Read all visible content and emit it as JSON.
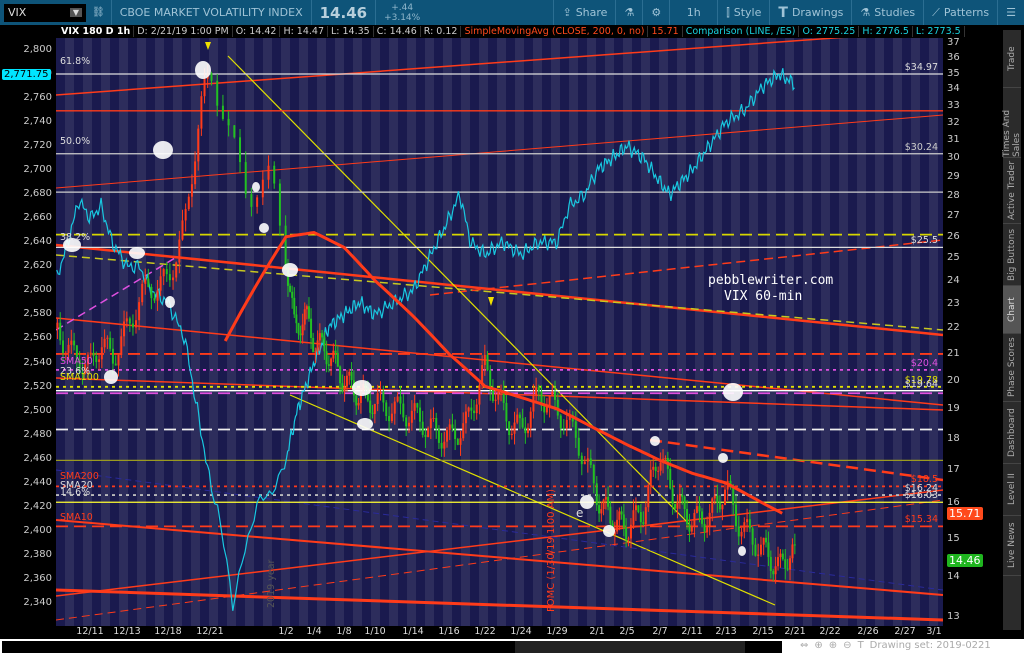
{
  "header": {
    "symbol": "VIX",
    "description": "CBOE MARKET VOLATILITY INDEX",
    "last": "14.46",
    "change": "+.44",
    "change_pct": "+3.14%",
    "buttons": [
      {
        "label": "Share",
        "icon": "share-icon"
      },
      {
        "label": "",
        "icon": "flask-icon"
      },
      {
        "label": "",
        "icon": "gear-icon"
      },
      {
        "label": "1h",
        "icon": ""
      },
      {
        "label": "Style",
        "icon": "candle-icon"
      },
      {
        "label": "Drawings",
        "icon": "text-t-icon"
      },
      {
        "label": "Studies",
        "icon": "flask-icon"
      },
      {
        "label": "Patterns",
        "icon": "pattern-icon"
      }
    ]
  },
  "infobar": {
    "title": "VIX 180 D 1h",
    "date": "D: 2/21/19 1:00 PM",
    "open": "O: 14.42",
    "high": "H: 14.47",
    "low": "L: 14.35",
    "close": "C: 14.46",
    "range": "R: 0.12",
    "study": "SimpleMovingAvg (CLOSE, 200, 0, no)",
    "study_value": "15.71",
    "comparison": "Comparison (LINE, /ES)",
    "cmp_open": "O: 2775.25",
    "cmp_high": "H: 2776.5",
    "cmp_low": "L: 2773.5"
  },
  "left_axis": {
    "ticks": [
      "2,800",
      "2,780",
      "2,760",
      "2,740",
      "2,720",
      "2,700",
      "2,680",
      "2,660",
      "2,640",
      "2,620",
      "2,600",
      "2,580",
      "2,560",
      "2,540",
      "2,520",
      "2,500",
      "2,480",
      "2,460",
      "2,440",
      "2,420",
      "2,400",
      "2,380",
      "2,360",
      "2,340"
    ],
    "tag": "2,771.75"
  },
  "right_axis": {
    "ticks": [
      "37",
      "36",
      "35",
      "34",
      "33",
      "32",
      "31",
      "30",
      "29",
      "28",
      "27",
      "26",
      "25",
      "24",
      "23",
      "22",
      "21",
      "20",
      "19",
      "18",
      "17",
      "16",
      "15",
      "14",
      "13"
    ],
    "tag_sma": "15.71",
    "tag_last": "14.46"
  },
  "colors": {
    "sma_tag": "#ff4a1c",
    "last_tag": "#1fb51f",
    "es_tag": "#00e5ff"
  },
  "left_labels": [
    "61.8%",
    "50.0%",
    "38.2%",
    "23.6%",
    "14.6%",
    "SMA50",
    "SMA100",
    "SMA200",
    "SMA20",
    "SMA10"
  ],
  "right_labels": [
    "$34.97",
    "$30.24",
    "$25.5",
    "$20.4",
    "$19.78",
    "$19.64",
    "$18.5",
    "$16.24",
    "$16.03",
    "$15.34"
  ],
  "annotations": {
    "site": "pebblewriter.com",
    "title": "VIX 60-min",
    "fomc": "FOMC (1/30/19 1:00 AM)",
    "year": "2019 year",
    "marker": "e"
  },
  "chart_data": {
    "type": "candlestick",
    "x_ticks": [
      "12/11",
      "12/13",
      "12/18",
      "12/21",
      "1/2",
      "1/4",
      "1/8",
      "1/10",
      "1/14",
      "1/16",
      "1/22",
      "1/24",
      "1/29",
      "2/1",
      "2/5",
      "2/7",
      "2/11",
      "2/13",
      "2/15",
      "2/21",
      "2/22",
      "2/26",
      "2/27",
      "3/1"
    ],
    "vix_scale": "log",
    "vix_range": [
      13,
      37
    ],
    "es_range": [
      2330,
      2810
    ],
    "vix_keyframes": [
      [
        -0.9,
        22
      ],
      [
        -0.5,
        21
      ],
      [
        0,
        20.5
      ],
      [
        0.3,
        21.5
      ],
      [
        0.6,
        20.8
      ],
      [
        1,
        22
      ],
      [
        1.4,
        23.5
      ],
      [
        2,
        24
      ],
      [
        2.4,
        26.5
      ],
      [
        2.8,
        33
      ],
      [
        3,
        35.5
      ],
      [
        3.2,
        32
      ],
      [
        3.5,
        28
      ],
      [
        3.8,
        29
      ],
      [
        4,
        25
      ],
      [
        4.3,
        22
      ],
      [
        4.7,
        22.5
      ],
      [
        5,
        21.5
      ],
      [
        5.5,
        21
      ],
      [
        6,
        20
      ],
      [
        6.5,
        19.5
      ],
      [
        7,
        19.2
      ],
      [
        7.5,
        19
      ],
      [
        8,
        18.8
      ],
      [
        8.5,
        18.3
      ],
      [
        9,
        18
      ],
      [
        9.5,
        18.5
      ],
      [
        10,
        20.5
      ],
      [
        10.3,
        19.5
      ],
      [
        10.7,
        18.5
      ],
      [
        11,
        18.3
      ],
      [
        11.5,
        19.5
      ],
      [
        12,
        19
      ],
      [
        12.5,
        18
      ],
      [
        13,
        16.2
      ],
      [
        13.5,
        15.5
      ],
      [
        14,
        15.3
      ],
      [
        14.5,
        15.8
      ],
      [
        15,
        17.6
      ],
      [
        15.3,
        16.5
      ],
      [
        15.7,
        15.8
      ],
      [
        16,
        15.5
      ],
      [
        16.5,
        15.6
      ],
      [
        17,
        16.5
      ],
      [
        17.3,
        15.5
      ],
      [
        17.7,
        15
      ],
      [
        18,
        14.7
      ],
      [
        18.5,
        14.2
      ],
      [
        18.9,
        14.7
      ],
      [
        19,
        14.46
      ]
    ],
    "es_keyframes": [
      [
        -0.9,
        2610
      ],
      [
        -0.6,
        2640
      ],
      [
        -0.3,
        2675
      ],
      [
        0,
        2660
      ],
      [
        0.3,
        2670
      ],
      [
        0.6,
        2640
      ],
      [
        1,
        2620
      ],
      [
        1.3,
        2620
      ],
      [
        1.6,
        2600
      ],
      [
        2,
        2590
      ],
      [
        2.4,
        2560
      ],
      [
        2.8,
        2480
      ],
      [
        3.1,
        2420
      ],
      [
        3.3,
        2340
      ],
      [
        3.6,
        2420
      ],
      [
        3.9,
        2440
      ],
      [
        4,
        2460
      ],
      [
        4.4,
        2500
      ],
      [
        5,
        2540
      ],
      [
        5.5,
        2570
      ],
      [
        6,
        2580
      ],
      [
        6.5,
        2590
      ],
      [
        7,
        2580
      ],
      [
        7.5,
        2590
      ],
      [
        8,
        2600
      ],
      [
        8.5,
        2630
      ],
      [
        9,
        2660
      ],
      [
        9.3,
        2680
      ],
      [
        9.6,
        2640
      ],
      [
        10,
        2630
      ],
      [
        10.5,
        2640
      ],
      [
        11,
        2630
      ],
      [
        11.5,
        2640
      ],
      [
        12,
        2640
      ],
      [
        12.3,
        2670
      ],
      [
        12.7,
        2680
      ],
      [
        13,
        2700
      ],
      [
        13.5,
        2710
      ],
      [
        14,
        2720
      ],
      [
        14.5,
        2710
      ],
      [
        15,
        2690
      ],
      [
        15.3,
        2680
      ],
      [
        16,
        2700
      ],
      [
        16.5,
        2720
      ],
      [
        17,
        2740
      ],
      [
        17.5,
        2750
      ],
      [
        18,
        2770
      ],
      [
        18.5,
        2780
      ],
      [
        18.8,
        2775
      ],
      [
        19,
        2771.75
      ]
    ],
    "sma200_keyframes": [
      [
        3.2,
        21.5
      ],
      [
        4,
        26
      ],
      [
        5,
        26.2
      ],
      [
        6,
        25.5
      ],
      [
        7,
        24
      ],
      [
        8,
        22.5
      ],
      [
        9,
        21
      ],
      [
        10,
        19.8
      ],
      [
        11,
        19.4
      ],
      [
        12,
        19
      ],
      [
        13,
        18.3
      ],
      [
        14,
        17.8
      ],
      [
        15,
        17.3
      ],
      [
        16,
        16.9
      ],
      [
        17,
        16.6
      ],
      [
        18,
        16
      ],
      [
        18.6,
        15.71
      ]
    ],
    "levels": [
      {
        "value": 34.97,
        "color": "#dddddd",
        "style": "solid",
        "label": "$34.97"
      },
      {
        "value": 32.7,
        "color": "#ff3b1a",
        "style": "solid"
      },
      {
        "value": 30.24,
        "color": "#cccccc",
        "style": "solid",
        "label": "$30.24"
      },
      {
        "value": 28.2,
        "color": "#cccccc",
        "style": "solid"
      },
      {
        "value": 26.1,
        "color": "#d6d600",
        "style": "dash"
      },
      {
        "value": 25.5,
        "color": "#dddddd",
        "style": "solid",
        "label": "$25.5"
      },
      {
        "value": 21,
        "color": "#ff3b1a",
        "style": "dash"
      },
      {
        "value": 20.4,
        "color": "#e050e0",
        "style": "dot",
        "label": "$20.4"
      },
      {
        "value": 19.78,
        "color": "#e0e000",
        "style": "dot",
        "label": "$19.78"
      },
      {
        "value": 19.64,
        "color": "#ffffff",
        "style": "solid",
        "label": "$19.64"
      },
      {
        "value": 19.55,
        "color": "#e050e0",
        "style": "dash"
      },
      {
        "value": 18.3,
        "color": "#eeeeee",
        "style": "dash"
      },
      {
        "value": 17.3,
        "color": "#9a9a20",
        "style": "solid"
      },
      {
        "value": 16.5,
        "color": "#ff3b1a",
        "style": "dot",
        "label": "$18.5"
      },
      {
        "value": 16.24,
        "color": "#bbbbbb",
        "style": "dot",
        "label": "$16.24"
      },
      {
        "value": 16.03,
        "color": "#ffff30",
        "style": "solid",
        "label": "$16.03"
      },
      {
        "value": 15.34,
        "color": "#ff3b1a",
        "style": "dash",
        "label": "$15.34"
      }
    ]
  },
  "sidebar": [
    "Trade",
    "Times And Sales",
    "Active Trader",
    "Big Buttons",
    "Chart",
    "Phase Scores",
    "Dashboard",
    "Level II",
    "Live News"
  ],
  "footer": {
    "drawing_set": "Drawing set: 2019-0221"
  }
}
